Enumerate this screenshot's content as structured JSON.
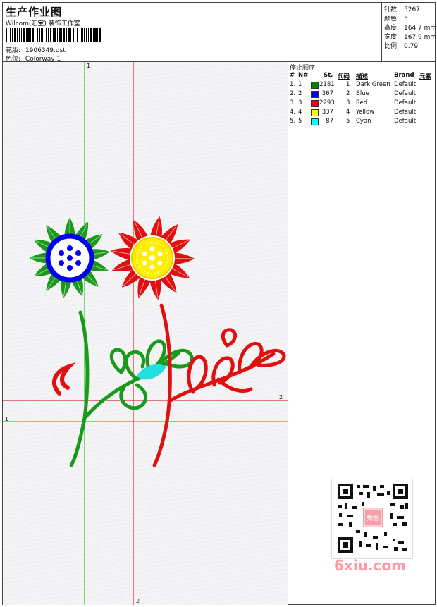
{
  "header": {
    "title": "生产作业图",
    "company": "Wilcom(汇宝) 装饰工作室",
    "design_label": "花版:",
    "design_file": "1906349.dst",
    "colorway_label": "色位:",
    "colorway": "Colorway 1"
  },
  "stats": [
    {
      "label": "针数:",
      "value": "5267"
    },
    {
      "label": "颜色:",
      "value": "5"
    },
    {
      "label": "高度:",
      "value": "164.7 mm"
    },
    {
      "label": "宽度:",
      "value": "167.9 mm"
    },
    {
      "label": "比例:",
      "value": "0.79"
    }
  ],
  "stop_sequence": {
    "title": "停止顺序:",
    "headers": {
      "num": "#",
      "n": "N#",
      "st": "St.",
      "code": "代码",
      "desc": "描述",
      "brand": "Brand",
      "element": "元素"
    },
    "rows": [
      {
        "num": "1.",
        "n": "1",
        "color": "#008000",
        "st": "2181",
        "code": "1",
        "desc": "Dark Green",
        "brand": "Default"
      },
      {
        "num": "2.",
        "n": "2",
        "color": "#0000ff",
        "st": "367",
        "code": "2",
        "desc": "Blue",
        "brand": "Default"
      },
      {
        "num": "3.",
        "n": "3",
        "color": "#ff0000",
        "st": "2293",
        "code": "3",
        "desc": "Red",
        "brand": "Default"
      },
      {
        "num": "4.",
        "n": "4",
        "color": "#ffff00",
        "st": "337",
        "code": "4",
        "desc": "Yellow",
        "brand": "Default"
      },
      {
        "num": "5.",
        "n": "5",
        "color": "#00ffff",
        "st": "87",
        "code": "5",
        "desc": "Cyan",
        "brand": "Default"
      }
    ]
  },
  "guides": {
    "v1": "1",
    "v2": "2",
    "h1": "1",
    "h2": "2",
    "color_v1": "#00c000",
    "color_v2": "#d00000"
  },
  "watermark": {
    "text": "6xiu.com",
    "seal": "秀图"
  }
}
